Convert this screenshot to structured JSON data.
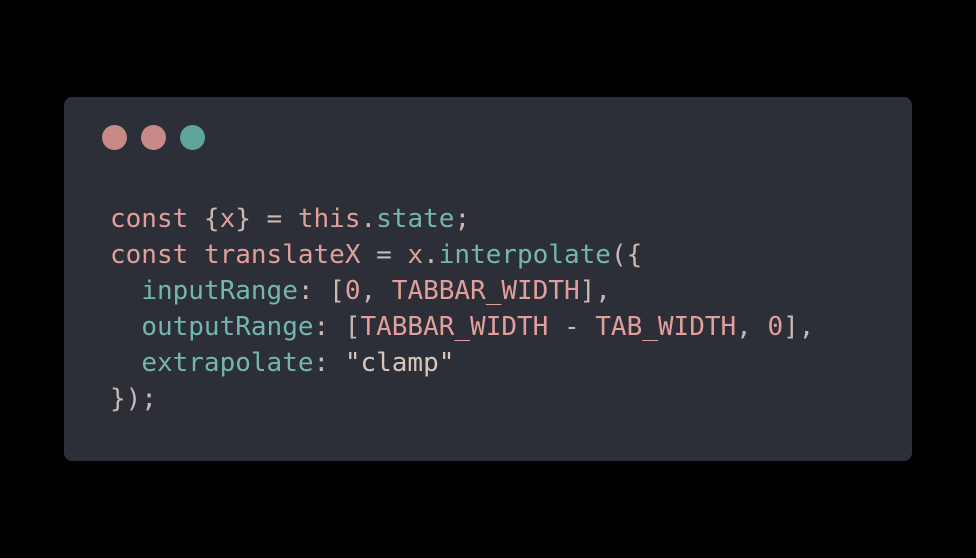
{
  "window": {
    "buttons": {
      "close_color": "#c88a86",
      "minimize_color": "#c88a86",
      "maximize_color": "#5fa39a"
    }
  },
  "code": {
    "lines": [
      [
        {
          "t": "const",
          "c": "kw"
        },
        {
          "t": " {",
          "c": "punct"
        },
        {
          "t": "x",
          "c": "id"
        },
        {
          "t": "} = ",
          "c": "punct"
        },
        {
          "t": "this",
          "c": "kw"
        },
        {
          "t": ".",
          "c": "punct"
        },
        {
          "t": "state",
          "c": "prop"
        },
        {
          "t": ";",
          "c": "punct"
        }
      ],
      [
        {
          "t": "const",
          "c": "kw"
        },
        {
          "t": " ",
          "c": "punct"
        },
        {
          "t": "translateX",
          "c": "id"
        },
        {
          "t": " = ",
          "c": "punct"
        },
        {
          "t": "x",
          "c": "id"
        },
        {
          "t": ".",
          "c": "punct"
        },
        {
          "t": "interpolate",
          "c": "prop"
        },
        {
          "t": "({",
          "c": "punct"
        }
      ],
      [
        {
          "t": "  ",
          "c": "punct"
        },
        {
          "t": "inputRange",
          "c": "prop"
        },
        {
          "t": ": [",
          "c": "punct"
        },
        {
          "t": "0",
          "c": "num"
        },
        {
          "t": ", ",
          "c": "punct"
        },
        {
          "t": "TABBAR_WIDTH",
          "c": "id"
        },
        {
          "t": "],",
          "c": "punct"
        }
      ],
      [
        {
          "t": "  ",
          "c": "punct"
        },
        {
          "t": "outputRange",
          "c": "prop"
        },
        {
          "t": ": [",
          "c": "punct"
        },
        {
          "t": "TABBAR_WIDTH",
          "c": "id"
        },
        {
          "t": " - ",
          "c": "punct"
        },
        {
          "t": "TAB_WIDTH",
          "c": "id"
        },
        {
          "t": ", ",
          "c": "punct"
        },
        {
          "t": "0",
          "c": "num"
        },
        {
          "t": "],",
          "c": "punct"
        }
      ],
      [
        {
          "t": "  ",
          "c": "punct"
        },
        {
          "t": "extrapolate",
          "c": "prop"
        },
        {
          "t": ": ",
          "c": "punct"
        },
        {
          "t": "\"clamp\"",
          "c": "str"
        }
      ],
      [
        {
          "t": "});",
          "c": "punct"
        }
      ]
    ]
  }
}
